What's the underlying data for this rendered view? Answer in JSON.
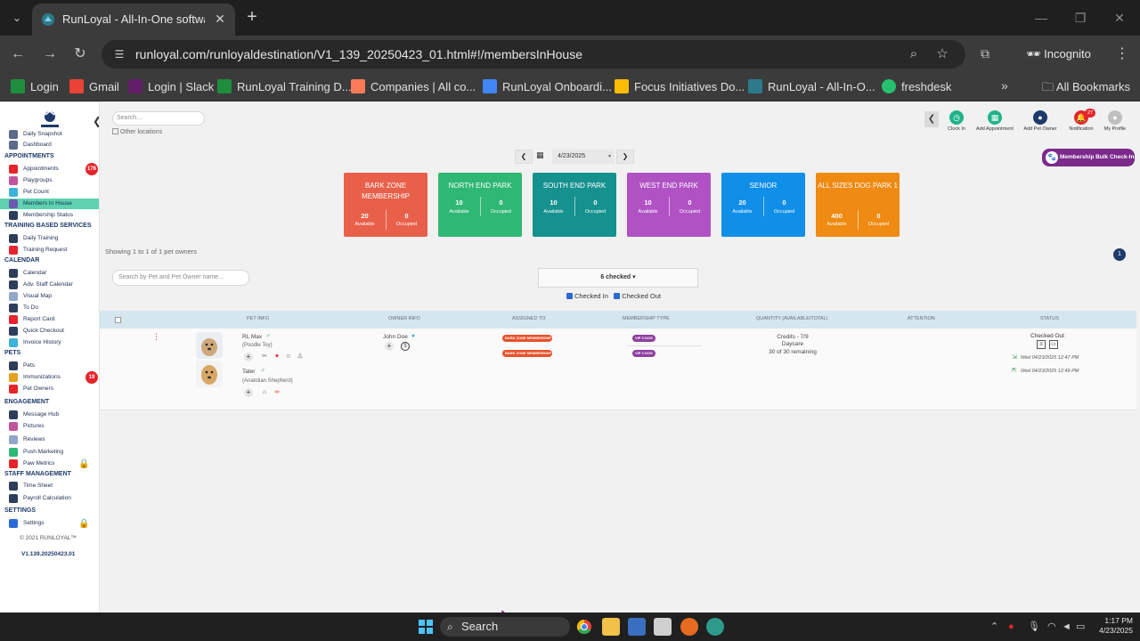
{
  "browser": {
    "tab_title": "RunLoyal - All-In-One software",
    "url": "runloyal.com/runloyaldestination/V1_139_20250423_01.html#!/membersInHouse",
    "incognito_label": "Incognito",
    "bookmarks": [
      {
        "label": "Login",
        "color": "#1e8e3e"
      },
      {
        "label": "Gmail",
        "color": "#ea4335"
      },
      {
        "label": "Login | Slack",
        "color": "#611f69"
      },
      {
        "label": "RunLoyal Training D...",
        "color": "#1e8e3e"
      },
      {
        "label": "Companies | All co...",
        "color": "#ff7a59"
      },
      {
        "label": "RunLoyal Onboardi...",
        "color": "#4285f4"
      },
      {
        "label": "Focus Initiatives Do...",
        "color": "#fbbc04"
      },
      {
        "label": "RunLoyal - All-In-O...",
        "color": "#2d7a8a"
      },
      {
        "label": "freshdesk",
        "color": "#25c16f"
      }
    ],
    "all_bookmarks": "All Bookmarks"
  },
  "sidebar": {
    "sections": [
      {
        "label": "APPOINTMENTS"
      },
      {
        "label": "TRAINING BASED SERVICES"
      },
      {
        "label": "CALENDAR"
      },
      {
        "label": "PETS"
      },
      {
        "label": "ENGAGEMENT"
      },
      {
        "label": "STAFF MANAGEMENT"
      },
      {
        "label": "SETTINGS"
      }
    ],
    "items": [
      {
        "label": "Daily Snapshot",
        "icon": "snapshot-icon"
      },
      {
        "label": "Dashboard",
        "icon": "dashboard-icon"
      },
      {
        "label": "Appointments",
        "icon": "appointments-icon",
        "badge": "176"
      },
      {
        "label": "Playgroups",
        "icon": "playgroups-icon"
      },
      {
        "label": "Pet Count",
        "icon": "pet-count-icon"
      },
      {
        "label": "Members In House",
        "icon": "members-icon"
      },
      {
        "label": "Membership Status",
        "icon": "membership-icon"
      },
      {
        "label": "Daily Training",
        "icon": "training-icon"
      },
      {
        "label": "Training Request",
        "icon": "training-request-icon"
      },
      {
        "label": "Calendar",
        "icon": "calendar-icon"
      },
      {
        "label": "Adv. Staff Calendar",
        "icon": "staff-calendar-icon"
      },
      {
        "label": "Visual Map",
        "icon": "map-icon"
      },
      {
        "label": "To Do",
        "icon": "todo-icon"
      },
      {
        "label": "Report Card",
        "icon": "report-icon"
      },
      {
        "label": "Quick Checkout",
        "icon": "checkout-icon"
      },
      {
        "label": "Invoice History",
        "icon": "invoice-icon"
      },
      {
        "label": "Pets",
        "icon": "pets-icon"
      },
      {
        "label": "Immunizations",
        "icon": "immunization-icon",
        "badge": "19"
      },
      {
        "label": "Pet Owners",
        "icon": "owners-icon"
      },
      {
        "label": "Message Hub",
        "icon": "message-icon"
      },
      {
        "label": "Pictures",
        "icon": "pictures-icon"
      },
      {
        "label": "Reviews",
        "icon": "reviews-icon"
      },
      {
        "label": "Push Marketing",
        "icon": "marketing-icon"
      },
      {
        "label": "Paw Metrics",
        "icon": "metrics-icon"
      },
      {
        "label": "Time Sheet",
        "icon": "timesheet-icon"
      },
      {
        "label": "Payroll Calculation",
        "icon": "payroll-icon"
      },
      {
        "label": "Settings",
        "icon": "settings-icon"
      }
    ],
    "copyright": "© 2021   RUNLOYAL™",
    "version": "V1.139.20250423.01"
  },
  "header": {
    "search_placeholder": "Search...",
    "other_locations": "Other locations",
    "actions": [
      {
        "label": "Clock In",
        "color": "#21b38a",
        "icon": "clock-icon"
      },
      {
        "label": "Add Appointment",
        "color": "#21b38a",
        "icon": "calendar-plus-icon"
      },
      {
        "label": "Add Pet Owner",
        "color": "#1e3a6a",
        "icon": "user-plus-icon"
      },
      {
        "label": "Notification",
        "color": "#e5252b",
        "icon": "bell-icon",
        "badge": "27"
      },
      {
        "label": "My Profile",
        "color": "#bfbfbf",
        "icon": "profile-icon"
      }
    ]
  },
  "date": {
    "value": "4/23/2025"
  },
  "bulk_checkin_label": "Membership Bulk Check-In",
  "membership_cards": [
    {
      "title": "BARK ZONE MEMBERSHIP",
      "available": "20",
      "occupied": "0",
      "color": "#e8604a"
    },
    {
      "title": "NORTH END PARK",
      "available": "10",
      "occupied": "0",
      "color": "#2fb774"
    },
    {
      "title": "SOUTH END PARK",
      "available": "10",
      "occupied": "0",
      "color": "#15918e"
    },
    {
      "title": "WEST END PARK",
      "available": "10",
      "occupied": "0",
      "color": "#b052c4"
    },
    {
      "title": "SENIOR",
      "available": "20",
      "occupied": "0",
      "color": "#0f8fe8"
    },
    {
      "title": "ALL SIZES DOG PARK 1",
      "available": "400",
      "occupied": "0",
      "color": "#ef8a12"
    }
  ],
  "card_labels": {
    "available": "Available",
    "occupied": "Occupied"
  },
  "showing_text": "Showing 1 to 1 of 1 pet owners",
  "page_number": "1",
  "pet_search_placeholder": "Search by Pet and Pet Owner name...",
  "checked_dropdown": "6 checked",
  "filters": {
    "checked_in": "Checked In",
    "checked_out": "Checked Out"
  },
  "table": {
    "headers": [
      "PET INFO",
      "OWNER INFO",
      "ASSIGNED TO",
      "MEMBERSHIP TYPE",
      "QUANTITY (AVAILABLE/TOTAL)",
      "ATTENTION",
      "STATUS"
    ],
    "row": {
      "pets": [
        {
          "name": "RL Max",
          "breed": "(Poodle Toy)"
        },
        {
          "name": "Tater",
          "breed": "(Anatolian Shepherd)"
        }
      ],
      "owner": "John Doe",
      "assigned": [
        "BARK ZONE MEMBERSHIP",
        "BARK ZONE MEMBERSHIP"
      ],
      "membership_types": [
        "VIP 3 DOG",
        "VIP 3 DOG"
      ],
      "quantity": {
        "credits": "Credits - 7/9",
        "service": "Daycare",
        "remaining": "30 of 30 remaining"
      },
      "status": "Checked Out",
      "stamps": [
        "Wed 04/23/2025 12:47 PM",
        "Wed 04/23/2025 12:49 PM"
      ]
    }
  },
  "taskbar": {
    "search_label": "Search",
    "time": "1:17 PM",
    "date": "4/23/2025"
  }
}
